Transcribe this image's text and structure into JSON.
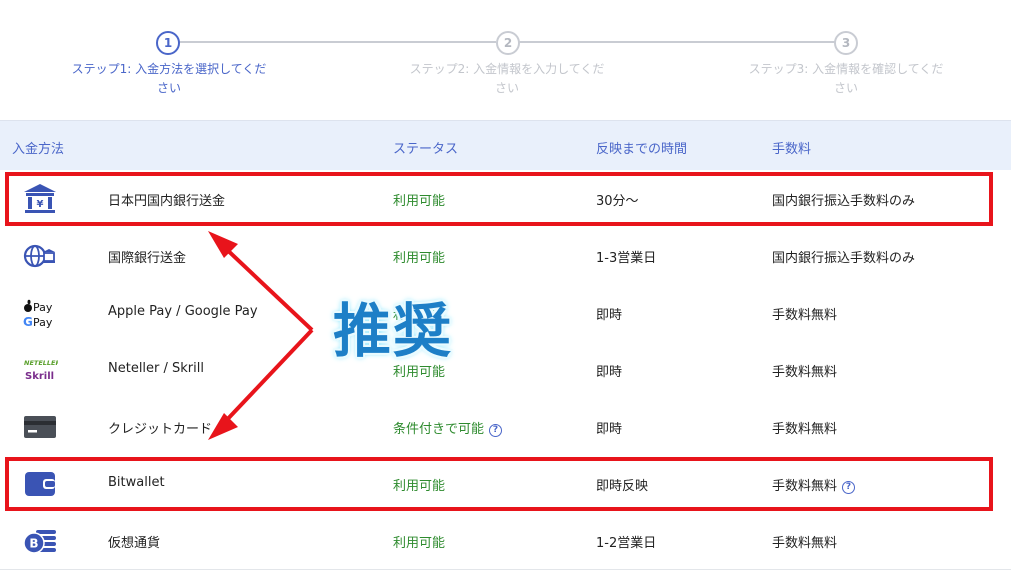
{
  "stepper": {
    "steps": [
      {
        "number": "1",
        "label_line1": "ステップ1: 入金方法を選択してくだ",
        "label_line2": "さい"
      },
      {
        "number": "2",
        "label_line1": "ステップ2: 入金情報を入力してくだ",
        "label_line2": "さい"
      },
      {
        "number": "3",
        "label_line1": "ステップ3: 入金情報を確認してくだ",
        "label_line2": "さい"
      }
    ],
    "active_step": 1
  },
  "table": {
    "headers": {
      "method": "入金方法",
      "status": "ステータス",
      "time": "反映までの時間",
      "fee": "手数料"
    },
    "rows": [
      {
        "icon": "bank-yen-icon",
        "method": "日本円国内銀行送金",
        "status": "利用可能",
        "time": "30分〜",
        "fee": "国内銀行振込手数料のみ"
      },
      {
        "icon": "globe-bank-icon",
        "method": "国際銀行送金",
        "status": "利用可能",
        "time": "1-3営業日",
        "fee": "国内銀行振込手数料のみ"
      },
      {
        "icon": "apple-google-pay-icon",
        "method": "Apple Pay / Google Pay",
        "status": "利用可能",
        "time": "即時",
        "fee": "手数料無料"
      },
      {
        "icon": "neteller-skrill-icon",
        "method": "Neteller / Skrill",
        "status": "利用可能",
        "time": "即時",
        "fee": "手数料無料"
      },
      {
        "icon": "credit-card-icon",
        "method": "クレジットカード",
        "status": "条件付きで可能",
        "time": "即時",
        "fee": "手数料無料"
      },
      {
        "icon": "wallet-icon",
        "method": "Bitwallet",
        "status": "利用可能",
        "time": "即時反映",
        "fee": "手数料無料"
      },
      {
        "icon": "crypto-coins-icon",
        "method": "仮想通貨",
        "status": "利用可能",
        "time": "1-2営業日",
        "fee": "手数料無料"
      }
    ]
  },
  "icons_text": {
    "apple_pay": "Pay",
    "google_pay": "Pay",
    "neteller": "NETELLER",
    "skrill": "Skrill"
  },
  "annotation": {
    "label": "推奨",
    "color": "#e8141b"
  },
  "colors": {
    "accent": "#4a66c9",
    "status_green": "#2e8b2e",
    "header_bg": "#e9f0fb"
  }
}
